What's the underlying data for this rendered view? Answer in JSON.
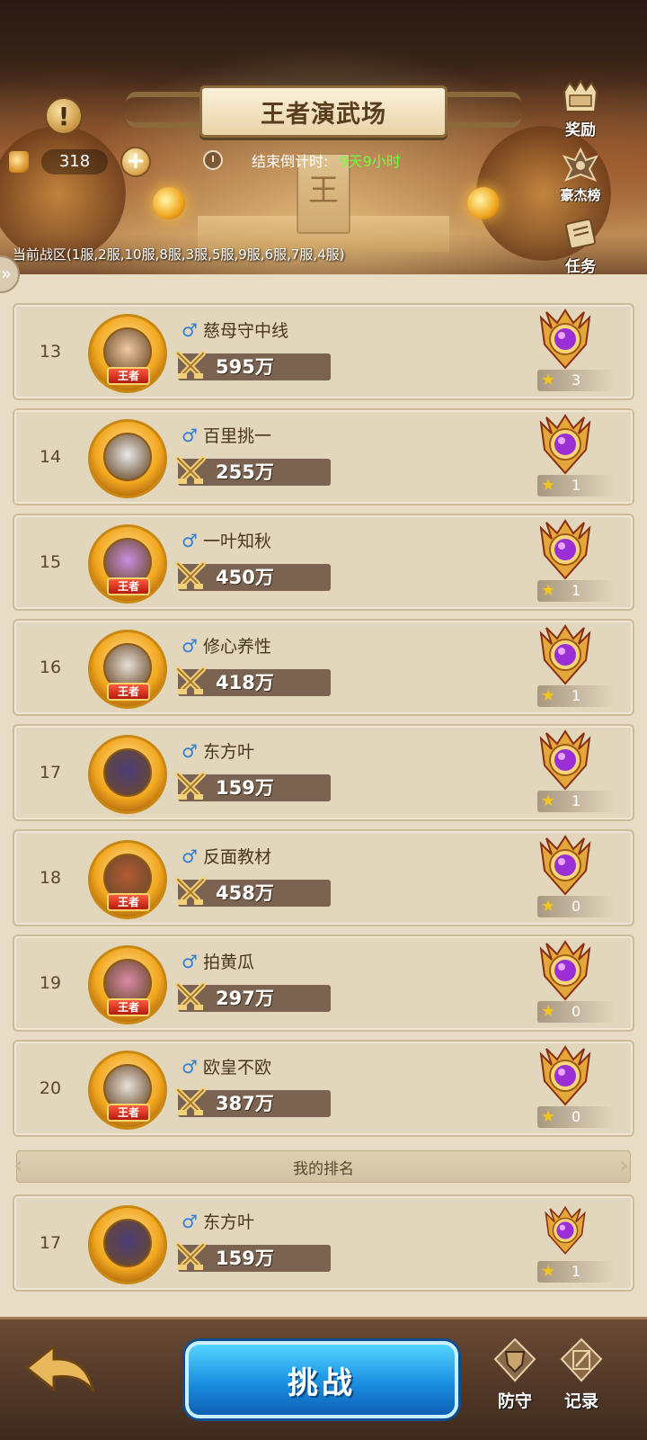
{
  "header": {
    "title": "王者演武场",
    "alert_icon": "exclamation-icon",
    "currency": {
      "icon": "coin-icon",
      "value": "318",
      "add_label": "+"
    },
    "timer": {
      "label": "结束倒计时:",
      "value": "9天9小时"
    },
    "zone_text": "当前战区(1服,2服,10服,8服,3服,5服,9服,6服,7服,4服)",
    "side_menu": [
      {
        "icon": "reward-chest-icon",
        "label": "奖励"
      },
      {
        "icon": "hero-ranking-icon",
        "label": "豪杰榜"
      },
      {
        "icon": "scroll-task-icon",
        "label": "任务"
      }
    ]
  },
  "badge_text": "王者",
  "rankings": [
    {
      "rank": "13",
      "name": "慈母守中线",
      "power": "595万",
      "stars": "3",
      "king_badge": true
    },
    {
      "rank": "14",
      "name": "百里挑一",
      "power": "255万",
      "stars": "1",
      "king_badge": false
    },
    {
      "rank": "15",
      "name": "一叶知秋",
      "power": "450万",
      "stars": "1",
      "king_badge": true
    },
    {
      "rank": "16",
      "name": "修心养性",
      "power": "418万",
      "stars": "1",
      "king_badge": true
    },
    {
      "rank": "17",
      "name": "东方叶",
      "power": "159万",
      "stars": "1",
      "king_badge": false
    },
    {
      "rank": "18",
      "name": "反面教材",
      "power": "458万",
      "stars": "0",
      "king_badge": true
    },
    {
      "rank": "19",
      "name": "拍黄瓜",
      "power": "297万",
      "stars": "0",
      "king_badge": true
    },
    {
      "rank": "20",
      "name": "欧皇不欧",
      "power": "387万",
      "stars": "0",
      "king_badge": true
    }
  ],
  "my_rank": {
    "label": "我的排名",
    "rank": "17",
    "name": "东方叶",
    "power": "159万",
    "stars": "1"
  },
  "gender_symbol": "♂",
  "star_symbol": "★",
  "bottom": {
    "back_icon": "back-arrow-icon",
    "challenge_label": "挑战",
    "defense_label": "防守",
    "defense_icon": "shield-icon",
    "record_label": "记录",
    "record_icon": "record-pencil-icon"
  },
  "colors": {
    "timer_value": "#6dff3d",
    "challenge_button": "#1b8fe0",
    "gender_male": "#2f7fd6",
    "star": "#f5c517",
    "list_background": "#e2d6bd"
  }
}
